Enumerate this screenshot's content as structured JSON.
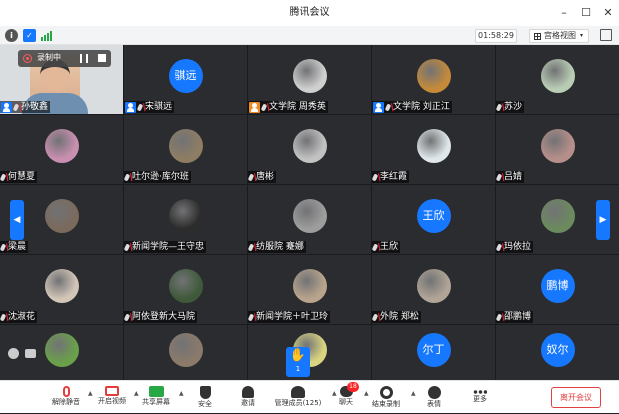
{
  "window": {
    "title": "腾讯会议"
  },
  "infobar": {
    "timer": "01:58:29",
    "view_label": "宫格视图"
  },
  "recording": {
    "label": "录制中"
  },
  "tiles": [
    {
      "name": "孙敬鑫",
      "kind": "video",
      "host_badge": true
    },
    {
      "name": "宋骐远",
      "kind": "text",
      "avatar_text": "骐远",
      "host_badge": true
    },
    {
      "name": "文学院 周秀英",
      "kind": "photo",
      "color": "#cfcfcf",
      "host_badge": true,
      "badge_color": "#f08a24"
    },
    {
      "name": "文学院 刘正江",
      "kind": "photo",
      "color": "#c48a3a",
      "host_badge": true
    },
    {
      "name": "苏沙",
      "kind": "photo",
      "color": "#b9cdb5"
    },
    {
      "name": "何慧夏",
      "kind": "photo",
      "color": "#c98fb0"
    },
    {
      "name": "吐尔逊·库尔班",
      "kind": "photo",
      "color": "#8e7d63"
    },
    {
      "name": "唐彬",
      "kind": "photo",
      "color": "#c2c2c2"
    },
    {
      "name": "李红霞",
      "kind": "photo",
      "color": "#dfe7ea"
    },
    {
      "name": "吕婧",
      "kind": "photo",
      "color": "#b78f8a"
    },
    {
      "name": "梁晨",
      "kind": "photo",
      "color": "#7a6a5c"
    },
    {
      "name": "新闻学院—王守忠",
      "kind": "photo",
      "color": "#2c2c2c"
    },
    {
      "name": "纺服院 蹇娜",
      "kind": "photo",
      "color": "#9d9d9d"
    },
    {
      "name": "王欣",
      "kind": "text",
      "avatar_text": "王欣"
    },
    {
      "name": "玛依拉",
      "kind": "photo",
      "color": "#6b8a5e"
    },
    {
      "name": "沈淑花",
      "kind": "photo",
      "color": "#d2c6b8"
    },
    {
      "name": "阿依登新大马院",
      "kind": "photo",
      "color": "#3f5a3a"
    },
    {
      "name": "新闻学院＋叶卫玲",
      "kind": "photo",
      "color": "#b8a48c"
    },
    {
      "name": "外院 郑松",
      "kind": "photo",
      "color": "#b0a596"
    },
    {
      "name": "邵鹏博",
      "kind": "text",
      "avatar_text": "鹏博"
    },
    {
      "name": "",
      "kind": "photo",
      "color": "#6aa04a"
    },
    {
      "name": "",
      "kind": "photo",
      "color": "#8b7a6a"
    },
    {
      "name": "",
      "kind": "photo",
      "color": "#d9d480"
    },
    {
      "name": "",
      "kind": "text",
      "avatar_text": "尔丁"
    },
    {
      "name": "",
      "kind": "text",
      "avatar_text": "奴尔"
    }
  ],
  "raise_hand": {
    "count": "1"
  },
  "toolbar": {
    "items": [
      {
        "label": "解除静音",
        "icon": "mic-muted-icon",
        "color": "#e23c3c"
      },
      {
        "label": "开启视频",
        "icon": "video-off-icon",
        "color": "#e23c3c"
      },
      {
        "label": "共享屏幕",
        "icon": "share-screen-icon",
        "color": "#28a745"
      },
      {
        "label": "安全",
        "icon": "shield-icon",
        "color": "#333333"
      },
      {
        "label": "邀请",
        "icon": "add-user-icon",
        "color": "#333333"
      },
      {
        "label": "管理成员(125)",
        "icon": "members-icon",
        "color": "#333333"
      },
      {
        "label": "聊天",
        "icon": "chat-icon",
        "color": "#333333"
      },
      {
        "label": "结束录制",
        "icon": "stop-record-icon",
        "color": "#333333"
      },
      {
        "label": "表情",
        "icon": "emoji-icon",
        "color": "#333333"
      },
      {
        "label": "更多",
        "icon": "more-icon",
        "color": "#333333"
      }
    ],
    "chat_badge": "18",
    "leave_label": "离开会议"
  }
}
